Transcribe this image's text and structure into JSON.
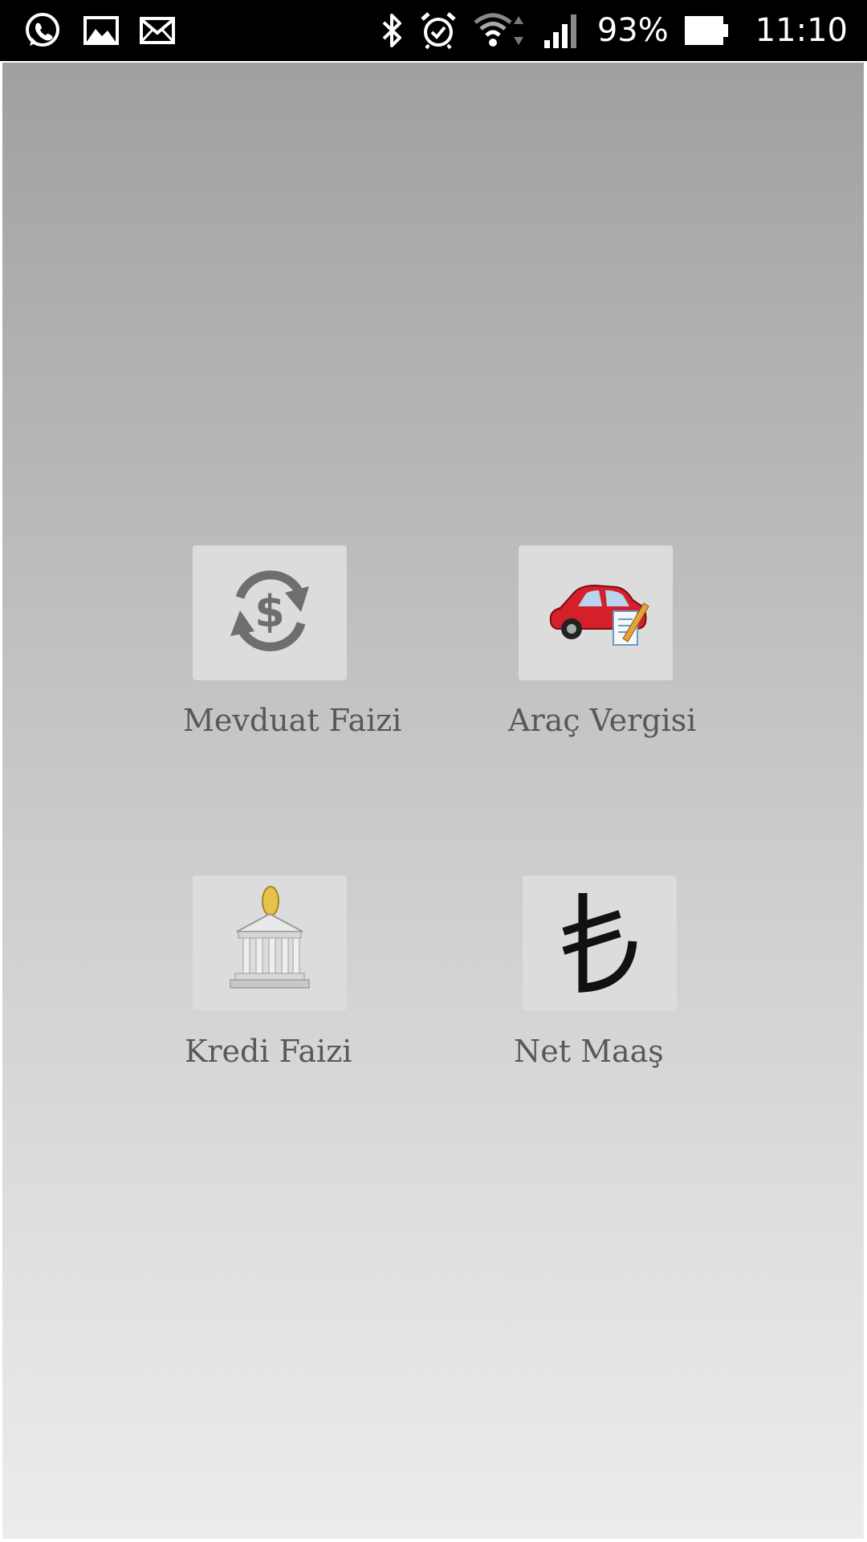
{
  "status_bar": {
    "left_icons": [
      "whatsapp-icon",
      "gallery-icon",
      "mail-icon"
    ],
    "right_icons": [
      "bluetooth-icon",
      "alarm-icon",
      "wifi-icon",
      "signal-icon"
    ],
    "battery_percent": "93%",
    "time": "11:10"
  },
  "menu": {
    "items": [
      {
        "label": "Mevduat Faizi",
        "icon": "currency-exchange-icon"
      },
      {
        "label": "Araç Vergisi",
        "icon": "car-icon"
      },
      {
        "label": "Kredi Faizi",
        "icon": "bank-icon"
      },
      {
        "label": "Net Maaş",
        "icon": "turkish-lira-icon"
      }
    ]
  },
  "colors": {
    "status_bar": "#000000",
    "label": "#585858",
    "tile": "#dcdcdc",
    "car_body": "#d4202a"
  }
}
